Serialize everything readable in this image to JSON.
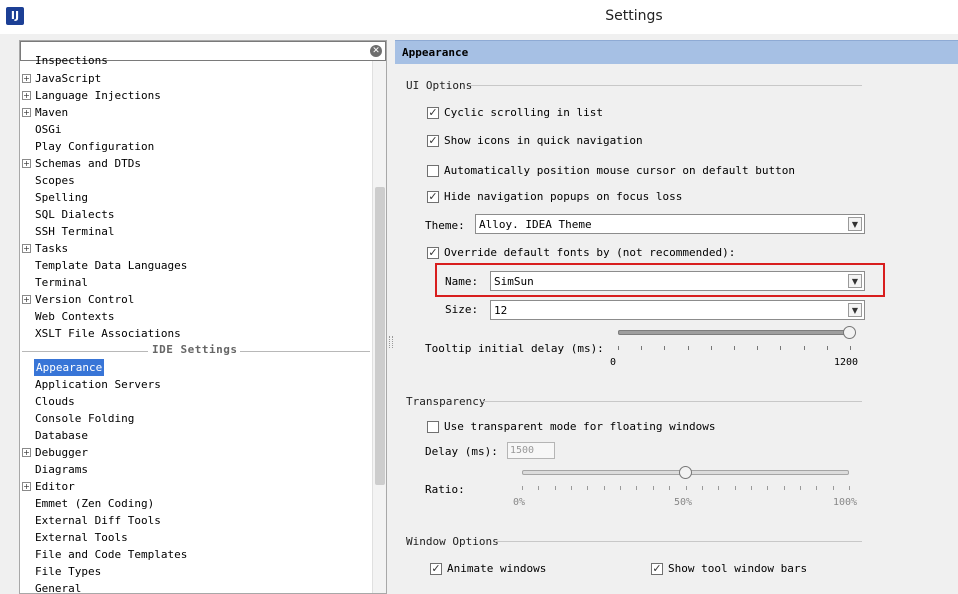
{
  "window": {
    "title": "Settings",
    "app_icon_text": "IJ"
  },
  "search": {
    "value": "",
    "clear_icon": "clear-icon"
  },
  "tree": {
    "top_partial": "Inspections",
    "project_items": [
      {
        "label": "JavaScript",
        "expandable": true
      },
      {
        "label": "Language Injections",
        "expandable": true
      },
      {
        "label": "Maven",
        "expandable": true
      },
      {
        "label": "OSGi",
        "expandable": false
      },
      {
        "label": "Play Configuration",
        "expandable": false
      },
      {
        "label": "Schemas and DTDs",
        "expandable": true
      },
      {
        "label": "Scopes",
        "expandable": false
      },
      {
        "label": "Spelling",
        "expandable": false
      },
      {
        "label": "SQL Dialects",
        "expandable": false
      },
      {
        "label": "SSH Terminal",
        "expandable": false
      },
      {
        "label": "Tasks",
        "expandable": true
      },
      {
        "label": "Template Data Languages",
        "expandable": false
      },
      {
        "label": "Terminal",
        "expandable": false
      },
      {
        "label": "Version Control",
        "expandable": true
      },
      {
        "label": "Web Contexts",
        "expandable": false
      },
      {
        "label": "XSLT File Associations",
        "expandable": false
      }
    ],
    "section_label": "IDE Settings",
    "ide_items": [
      {
        "label": "Appearance",
        "expandable": false,
        "selected": true
      },
      {
        "label": "Application Servers",
        "expandable": false
      },
      {
        "label": "Clouds",
        "expandable": false
      },
      {
        "label": "Console Folding",
        "expandable": false
      },
      {
        "label": "Database",
        "expandable": false
      },
      {
        "label": "Debugger",
        "expandable": true
      },
      {
        "label": "Diagrams",
        "expandable": false
      },
      {
        "label": "Editor",
        "expandable": true
      },
      {
        "label": "Emmet (Zen Coding)",
        "expandable": false
      },
      {
        "label": "External Diff Tools",
        "expandable": false
      },
      {
        "label": "External Tools",
        "expandable": false
      },
      {
        "label": "File and Code Templates",
        "expandable": false
      },
      {
        "label": "File Types",
        "expandable": false
      },
      {
        "label": "General",
        "expandable": false
      }
    ]
  },
  "page": {
    "title": "Appearance",
    "ui_options": {
      "group_label": "UI Options",
      "cyclic_scrolling": {
        "label": "Cyclic scrolling in list",
        "checked": true
      },
      "show_icons": {
        "label": "Show icons in quick navigation",
        "checked": true
      },
      "auto_position": {
        "label": "Automatically position mouse cursor on default button",
        "checked": false
      },
      "hide_popups": {
        "label": "Hide navigation popups on focus loss",
        "checked": true
      },
      "theme_label": "Theme:",
      "theme_value": "Alloy. IDEA Theme",
      "override_fonts": {
        "label": "Override default fonts by (not recommended):",
        "checked": true
      },
      "name_label": "Name:",
      "name_value": "SimSun",
      "size_label": "Size:",
      "size_value": "12",
      "tooltip_label": "Tooltip initial delay (ms):",
      "tooltip_min": "0",
      "tooltip_max": "1200",
      "tooltip_value": 1200
    },
    "transparency": {
      "group_label": "Transparency",
      "transparent_mode": {
        "label": "Use transparent mode for floating windows",
        "checked": false
      },
      "delay_label": "Delay (ms):",
      "delay_value": "1500",
      "ratio_label": "Ratio:",
      "ratio_ticks": [
        "0%",
        "50%",
        "100%"
      ],
      "ratio_value": 0.5
    },
    "window_options": {
      "group_label": "Window Options",
      "animate_windows": {
        "label": "Animate windows",
        "checked": true
      },
      "show_tool_window_bars": {
        "label": "Show tool window bars",
        "checked": true
      }
    }
  }
}
